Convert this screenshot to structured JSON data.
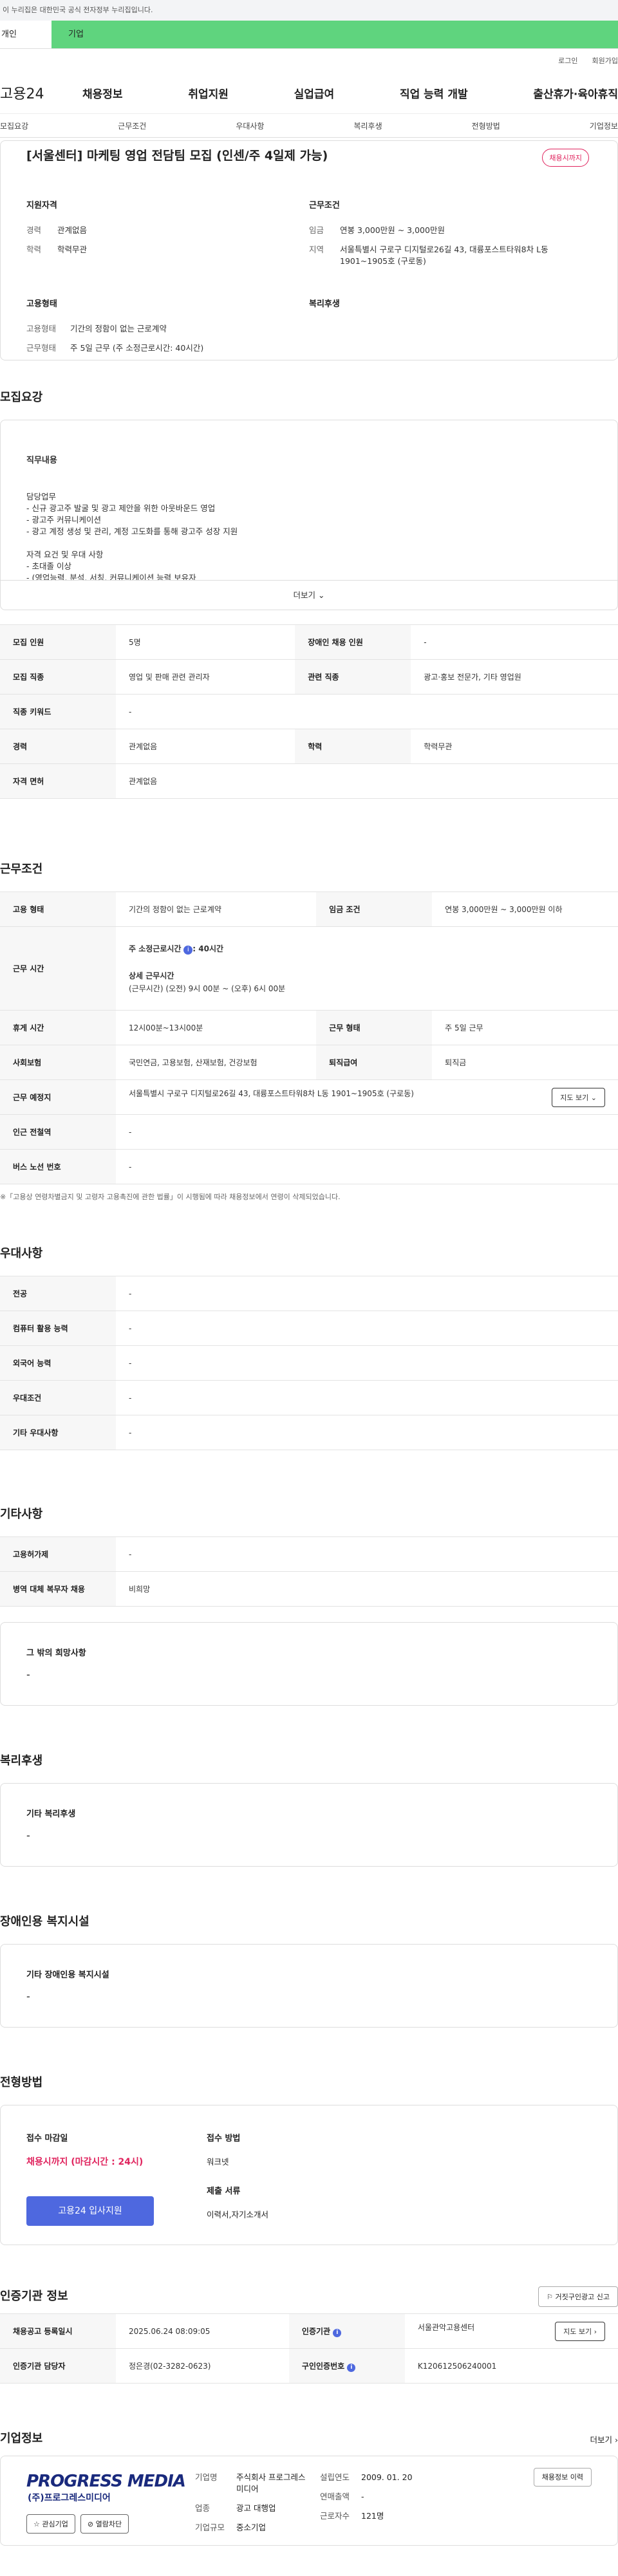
{
  "gov_banner": "이 누리집은 대한민국 공식 전자정부 누리집입니다.",
  "top_tabs": {
    "personal": "개인",
    "company": "기업"
  },
  "util_links": [
    "로그인",
    "회원가입"
  ],
  "logo": "고용24",
  "gnb": [
    "채용정보",
    "취업지원",
    "실업급여",
    "직업 능력 개발",
    "출산휴가·육아휴직"
  ],
  "anchor_nav": [
    "모집요강",
    "근무조건",
    "우대사항",
    "복리후생",
    "전형방법",
    "기업정보"
  ],
  "summary": {
    "title": "[서울센터] 마케팅 영업 전담팀 모집 (인센/주 4일제 가능)",
    "badge": "채용시까지",
    "qual_title": "지원자격",
    "qual": [
      {
        "k": "경력",
        "v": "관계없음"
      },
      {
        "k": "학력",
        "v": "학력무관"
      }
    ],
    "cond_title": "근무조건",
    "cond": [
      {
        "k": "임금",
        "v": "연봉 3,000만원 ~ 3,000만원"
      },
      {
        "k": "지역",
        "v": "서울특별시 구로구 디지털로26길 43, 대륭포스트타워8차 L동 1901~1905호 (구로동)"
      }
    ],
    "emp_title": "고용형태",
    "emp": [
      {
        "k": "고용형태",
        "v": "기간의 정함이 없는 근로계약"
      },
      {
        "k": "근무형태",
        "v": "주 5일 근무 (주 소정근로시간: 40시간)"
      }
    ],
    "welfare_title": "복리후생"
  },
  "recruit": {
    "title": "모집요강",
    "duty_title": "직무내용",
    "duty_text": "담당업무\n- 신규 광고주 발굴 및 광고 제안을 위한 아웃바운드 영업\n- 광고주 커뮤니케이션\n- 광고 계정 생성 및 관리, 계정 고도화를 통해 광고주 성장 지원\n\n자격 요건 및 우대 사항\n- 초대졸 이상\n- (영업능력, 분석, 서칭, 커뮤니케이션 능력 보유자\n- 학습능력 보유자",
    "more": "더보기",
    "rows": [
      [
        "모집 인원",
        "5명",
        "장애인 채용 인원",
        "-"
      ],
      [
        "모집 직종",
        "영업 및 판매 관련 관리자",
        "관련 직종",
        "광고·홍보 전문가, 기타 영업원"
      ],
      [
        "직종 키워드",
        "-"
      ],
      [
        "경력",
        "관계없음",
        "학력",
        "학력무관"
      ],
      [
        "자격 면허",
        "관계없음"
      ]
    ]
  },
  "work": {
    "title": "근무조건",
    "emp_type": [
      "고용 형태",
      "기간의 정함이 없는 근로계약",
      "임금 조건",
      "연봉 3,000만원 ~ 3,000만원 이하"
    ],
    "hours_label": "근무 시간",
    "hours_main": "주 소정근로시간",
    "hours_main_val": ": 40시간",
    "hours_detail_title": "상세 근무시간",
    "hours_detail": "(근무시간) (오전) 9시 00분 ~ (오후) 6시 00분",
    "rows": [
      [
        "휴게 시간",
        "12시00분~13시00분",
        "근무 형태",
        "주 5일 근무"
      ],
      [
        "사회보험",
        "국민연금, 고용보험, 산재보험, 건강보험",
        "퇴직급여",
        "퇴직금"
      ]
    ],
    "place_label": "근무 예정지",
    "place": "서울특별시 구로구 디지털로26길 43, 대륭포스트타워8차 L동 1901~1905호 (구로동)",
    "map_btn": "지도 보기",
    "rows2": [
      [
        "인근 전철역",
        "-"
      ],
      [
        "버스 노선 번호",
        "-"
      ]
    ],
    "note": "※「고용상 연령차별금지 및 고령자 고용촉진에 관한 법률」이 시행됨에 따라 채용정보에서 연령이 삭제되었습니다."
  },
  "pref": {
    "title": "우대사항",
    "rows": [
      [
        "전공",
        "-"
      ],
      [
        "컴퓨터 활용 능력",
        "-"
      ],
      [
        "외국어 능력",
        "-"
      ],
      [
        "우대조건",
        "-"
      ],
      [
        "기타 우대사항",
        "-"
      ]
    ]
  },
  "etc": {
    "title": "기타사항",
    "rows": [
      [
        "고용허가제",
        "-"
      ],
      [
        "병역 대체 복무자 채용",
        "비희망"
      ]
    ],
    "hope_title": "그 밖의 희망사항",
    "hope_val": "-"
  },
  "welfare": {
    "title": "복리후생",
    "card_title": "기타 복리후생",
    "val": "-"
  },
  "disabled": {
    "title": "장애인용 복지시설",
    "card_title": "기타 장애인용 복지시설",
    "val": "-"
  },
  "process": {
    "title": "전형방법",
    "deadline_title": "접수 마감일",
    "deadline": "채용시까지 (마감시간 : 24시)",
    "method_title": "접수 방법",
    "method": "워크넷",
    "docs_title": "제출 서류",
    "docs": "이력서,자기소개서",
    "apply_btn": "고용24 입사지원"
  },
  "cert": {
    "title": "인증기관 정보",
    "report_btn": "거짓구인광고 신고",
    "rows": [
      [
        "채용공고 등록일시",
        "2025.06.24 08:09:05",
        "인증기관",
        "서울관악고용센터"
      ],
      [
        "인증기관 담당자",
        "정은경(02-3282-0623)",
        "구인인증번호",
        "K120612506240001"
      ]
    ],
    "map_btn": "지도 보기"
  },
  "company": {
    "title": "기업정보",
    "more": "더보기",
    "logo_text": "PROGRESS MEDIA",
    "logo_sub": "(주)프로그레스미디어",
    "fav_btn": "관심기업",
    "block_btn": "열람차단",
    "info1": [
      {
        "k": "기업명",
        "v": "주식회사 프로그레스미디어"
      },
      {
        "k": "업종",
        "v": "광고 대행업"
      },
      {
        "k": "기업규모",
        "v": "중소기업"
      }
    ],
    "info2": [
      {
        "k": "설립연도",
        "v": "2009. 01. 20"
      },
      {
        "k": "연매출액",
        "v": "-"
      },
      {
        "k": "근로자수",
        "v": "121명"
      }
    ],
    "jobs_btn": "채용정보 이력"
  },
  "colors": {
    "accent": "#4e68df",
    "badge": "#e0245e",
    "green": "#5fd47e"
  }
}
